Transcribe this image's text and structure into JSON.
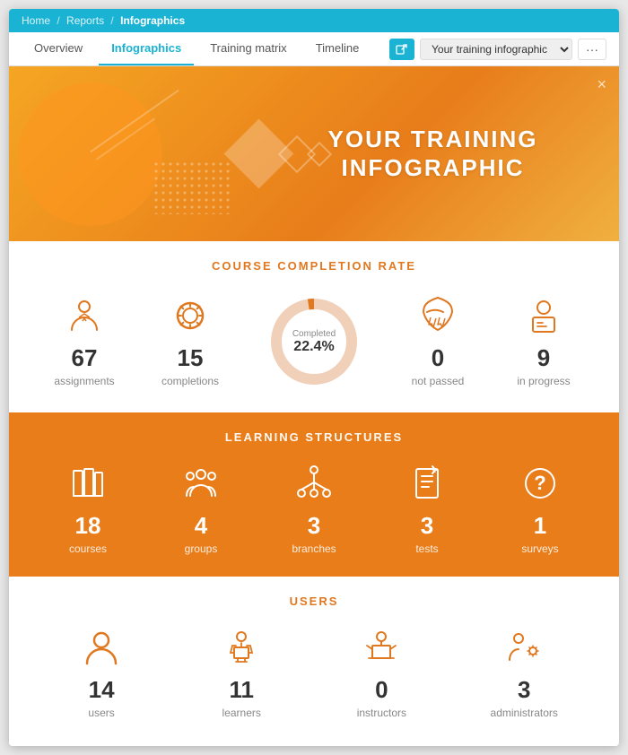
{
  "titlebar": {
    "breadcrumb": [
      "Home",
      "Reports",
      "Infographics"
    ]
  },
  "tabs": {
    "items": [
      "Overview",
      "Infographics",
      "Training matrix",
      "Timeline"
    ],
    "active": "Infographics",
    "dropdown_value": "Your training infographic"
  },
  "hero": {
    "title_line1": "YOUR TRAINING",
    "title_line2": "INFOGRAPHIC",
    "close_icon": "×"
  },
  "course_completion": {
    "section_title": "COURSE COMPLETION RATE",
    "stats": [
      {
        "id": "assignments",
        "number": "67",
        "label": "assignments"
      },
      {
        "id": "completions",
        "number": "15",
        "label": "completions"
      },
      {
        "id": "donut",
        "completed_label": "Completed",
        "percent": "22.4%",
        "filled": 22.4
      },
      {
        "id": "not_passed",
        "number": "0",
        "label": "not passed"
      },
      {
        "id": "in_progress",
        "number": "9",
        "label": "in progress"
      }
    ]
  },
  "learning_structures": {
    "section_title": "LEARNING STRUCTURES",
    "stats": [
      {
        "id": "courses",
        "number": "18",
        "label": "courses"
      },
      {
        "id": "groups",
        "number": "4",
        "label": "groups"
      },
      {
        "id": "branches",
        "number": "3",
        "label": "branches"
      },
      {
        "id": "tests",
        "number": "3",
        "label": "tests"
      },
      {
        "id": "surveys",
        "number": "1",
        "label": "surveys"
      }
    ]
  },
  "users": {
    "section_title": "USERS",
    "stats": [
      {
        "id": "users",
        "number": "14",
        "label": "users"
      },
      {
        "id": "learners",
        "number": "11",
        "label": "learners"
      },
      {
        "id": "instructors",
        "number": "0",
        "label": "instructors"
      },
      {
        "id": "administrators",
        "number": "3",
        "label": "administrators"
      }
    ]
  }
}
